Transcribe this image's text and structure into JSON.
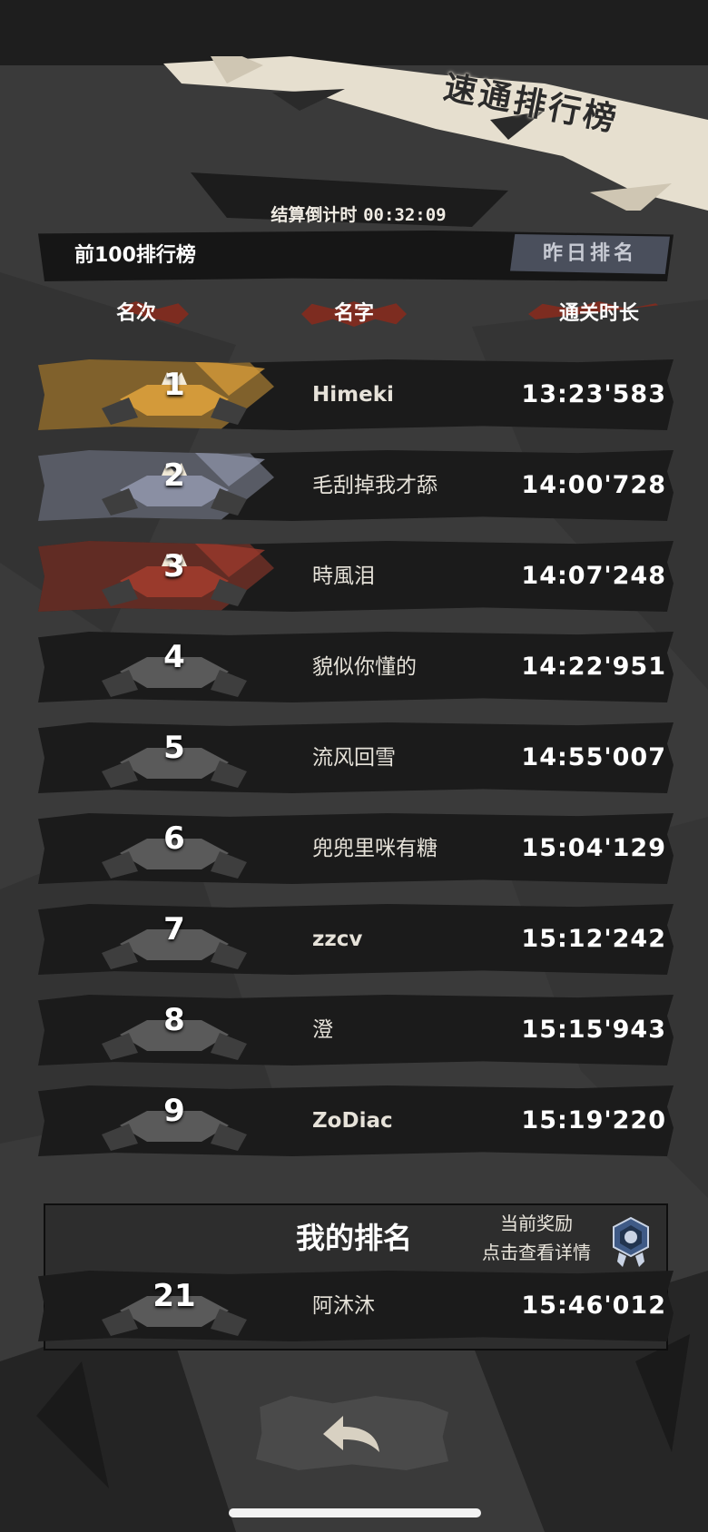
{
  "header": {
    "title": "速通排行榜",
    "countdown_label": "结算倒计时",
    "countdown_value": "00:32:09",
    "top100_label": "前100排行榜",
    "yesterday_button": "昨日排名"
  },
  "columns": {
    "rank": "名次",
    "name": "名字",
    "time": "通关时长"
  },
  "leaderboard": [
    {
      "rank": "1",
      "name": "Himeki",
      "time": "13:23'583",
      "tier": "gold"
    },
    {
      "rank": "2",
      "name": "毛刮掉我才舔",
      "time": "14:00'728",
      "tier": "silver"
    },
    {
      "rank": "3",
      "name": "時風泪",
      "time": "14:07'248",
      "tier": "bronze"
    },
    {
      "rank": "4",
      "name": "貌似你懂的",
      "time": "14:22'951",
      "tier": "normal"
    },
    {
      "rank": "5",
      "name": "流风回雪",
      "time": "14:55'007",
      "tier": "normal"
    },
    {
      "rank": "6",
      "name": "兜兜里咪有糖",
      "time": "15:04'129",
      "tier": "normal"
    },
    {
      "rank": "7",
      "name": "zzcv",
      "time": "15:12'242",
      "tier": "normal"
    },
    {
      "rank": "8",
      "name": "澄",
      "time": "15:15'943",
      "tier": "normal"
    },
    {
      "rank": "9",
      "name": "ZoDiac",
      "time": "15:19'220",
      "tier": "normal"
    }
  ],
  "my_rank": {
    "title": "我的排名",
    "reward_line1": "当前奖励",
    "reward_line2": "点击查看详情",
    "rank": "21",
    "name": "阿沐沐",
    "time": "15:46'012"
  },
  "icons": {
    "back": "back-arrow-icon",
    "medal": "medal-icon",
    "crown": "crown-icon"
  },
  "colors": {
    "gold": "#d39a3a",
    "silver": "#8a8fa3",
    "bronze": "#9a3a2c",
    "accent_red": "#8a2a1c",
    "row_bg": "#1b1b1b",
    "page_bg": "#3a3a3a"
  }
}
